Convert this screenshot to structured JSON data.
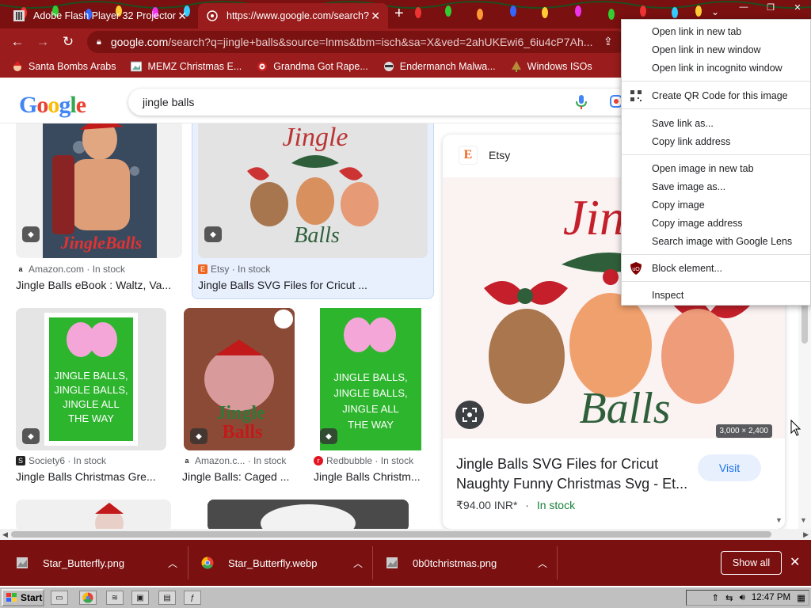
{
  "tabs": [
    {
      "title": "Adobe Flash Player 32 Projector",
      "close": "✕"
    },
    {
      "title": "https://www.google.com/search?",
      "close": "✕"
    }
  ],
  "new_tab": "+",
  "window_controls": {
    "minimize": "—",
    "restore": "❐",
    "close": "✕"
  },
  "toolbar": {
    "back": "←",
    "forward": "→",
    "reload": "↻",
    "url_host": "google.com",
    "url_path": "/search?q=jingle+balls&source=lnms&tbm=isch&sa=X&ved=2ahUKEwi6_6iu4cP7Ah..."
  },
  "bookmarks": [
    {
      "label": "Santa Bombs Arabs",
      "icon": "santa-icon"
    },
    {
      "label": "MEMZ Christmas E...",
      "icon": "image-icon"
    },
    {
      "label": "Grandma Got Rape...",
      "icon": "target-icon"
    },
    {
      "label": "Endermanch Malwa...",
      "icon": "raccoon-icon"
    },
    {
      "label": "Windows ISOs",
      "icon": "tree-icon"
    }
  ],
  "google": {
    "logo": "Google",
    "query": "jingle balls"
  },
  "results": [
    {
      "source": "Amazon.com",
      "stock": "In stock",
      "title": "Jingle Balls eBook : Waltz, Va..."
    },
    {
      "source": "Etsy",
      "stock": "In stock",
      "title": "Jingle Balls SVG Files for Cricut ..."
    },
    {
      "source": "Society6",
      "stock": "In stock",
      "title": "Jingle Balls Christmas Gre..."
    },
    {
      "source": "Amazon.c...",
      "stock": "In stock",
      "title": "Jingle Balls: Caged ..."
    },
    {
      "source": "Redbubble",
      "stock": "In stock",
      "title": "Jingle Balls Christm..."
    }
  ],
  "thumb_text": {
    "jingle": "Jingle",
    "balls": "Balls",
    "book_title": "JingleBalls",
    "poster": [
      "JINGLE BALLS,",
      "JINGLE BALLS,",
      "JINGLE ALL",
      "THE WAY"
    ],
    "caged_jingle": "Jingle",
    "caged_balls": "Balls"
  },
  "panel": {
    "site": "Etsy",
    "title": "Jingle Balls SVG Files for Cricut Naughty Funny Christmas Svg - Et...",
    "price": "₹94.00 INR*",
    "dot": "·",
    "stock": "In stock",
    "visit": "Visit",
    "dimensions": "3,000 × 2,400"
  },
  "context_menu": [
    {
      "label": "Open link in new tab"
    },
    {
      "label": "Open link in new window"
    },
    {
      "label": "Open link in incognito window"
    },
    {
      "label": "Create QR Code for this image"
    },
    {
      "label": "Save link as..."
    },
    {
      "label": "Copy link address"
    },
    {
      "label": "Open image in new tab"
    },
    {
      "label": "Save image as..."
    },
    {
      "label": "Copy image"
    },
    {
      "label": "Copy image address"
    },
    {
      "label": "Search image with Google Lens"
    },
    {
      "label": "Block element..."
    },
    {
      "label": "Inspect"
    }
  ],
  "downloads": [
    {
      "name": "Star_Butterfly.png"
    },
    {
      "name": "Star_Butterfly.webp"
    },
    {
      "name": "0b0tchristmas.png"
    }
  ],
  "show_all": "Show all",
  "taskbar": {
    "start": "Start",
    "clock": "12:47 PM"
  },
  "colors": {
    "chrome_frame": "#7a1010",
    "toolbar": "#9a1c1c",
    "link_blue": "#1a73e8",
    "in_stock_green": "#188038"
  }
}
